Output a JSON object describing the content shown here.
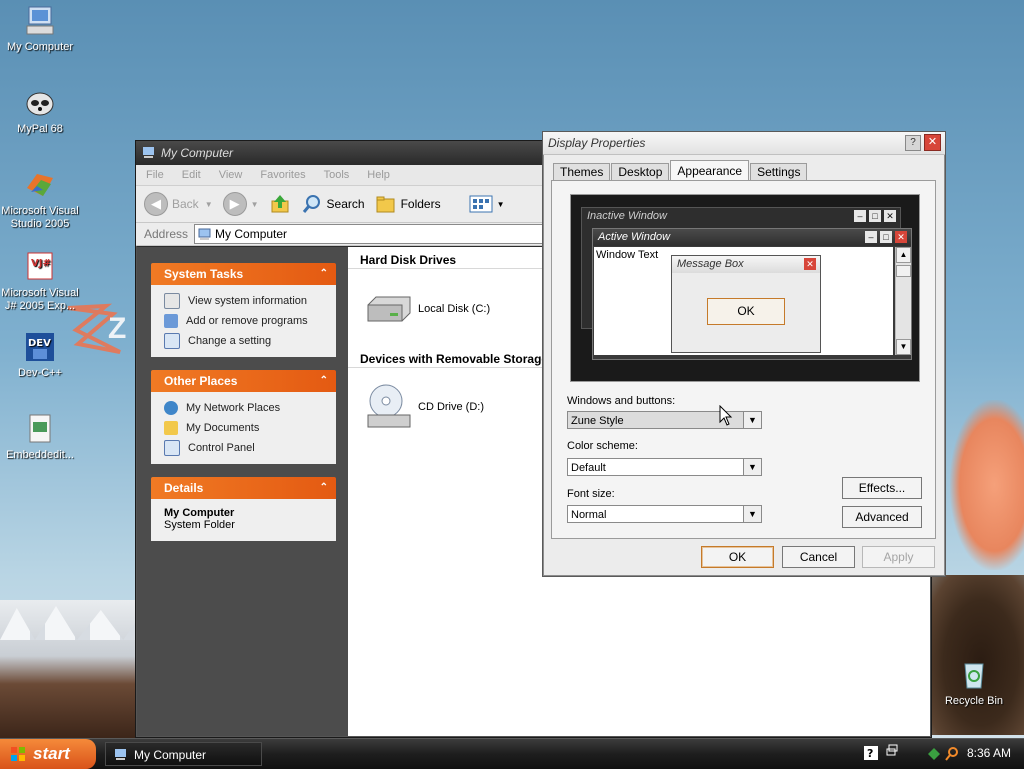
{
  "desktop": {
    "icons": [
      {
        "label": "My Computer"
      },
      {
        "label": "MyPal 68"
      },
      {
        "label": "Microsoft Visual Studio 2005"
      },
      {
        "label": "Microsoft Visual J# 2005 Exp..."
      },
      {
        "label": "Dev-C++"
      },
      {
        "label": "Embeddedit..."
      },
      {
        "label": "Recycle Bin"
      }
    ],
    "logo_letter": "Z"
  },
  "explorer": {
    "title": "My Computer",
    "menu": [
      "File",
      "Edit",
      "View",
      "Favorites",
      "Tools",
      "Help"
    ],
    "toolbar": {
      "back": "Back",
      "search": "Search",
      "folders": "Folders"
    },
    "address": {
      "label": "Address",
      "value": "My Computer"
    },
    "system_tasks": {
      "title": "System Tasks",
      "items": [
        "View system information",
        "Add or remove programs",
        "Change a setting"
      ]
    },
    "other_places": {
      "title": "Other Places",
      "items": [
        "My Network Places",
        "My Documents",
        "Control Panel"
      ]
    },
    "details": {
      "title": "Details",
      "name": "My Computer",
      "type": "System Folder"
    },
    "groups": [
      {
        "title": "Hard Disk Drives",
        "items": [
          "Local Disk (C:)"
        ]
      },
      {
        "title": "Devices with Removable Storage",
        "items": [
          "CD Drive (D:)"
        ]
      }
    ]
  },
  "display_properties": {
    "title": "Display Properties",
    "tabs": [
      "Themes",
      "Desktop",
      "Appearance",
      "Settings"
    ],
    "active_tab": "Appearance",
    "preview": {
      "inactive_title": "Inactive Window",
      "active_title": "Active Window",
      "window_text": "Window Text",
      "message_title": "Message Box",
      "ok": "OK"
    },
    "windows_buttons": {
      "label": "Windows and buttons:",
      "value": "Zune Style"
    },
    "color_scheme": {
      "label": "Color scheme:",
      "value": "Default"
    },
    "font_size": {
      "label": "Font size:",
      "value": "Normal"
    },
    "effects": "Effects...",
    "advanced": "Advanced",
    "ok": "OK",
    "cancel": "Cancel",
    "apply": "Apply"
  },
  "taskbar": {
    "start": "start",
    "task": "My Computer",
    "clock": "8:36 AM"
  },
  "colors": {
    "accent_orange": "#e45a12",
    "dark_chrome": "#2c2c2c",
    "close_red": "#d7463a"
  }
}
